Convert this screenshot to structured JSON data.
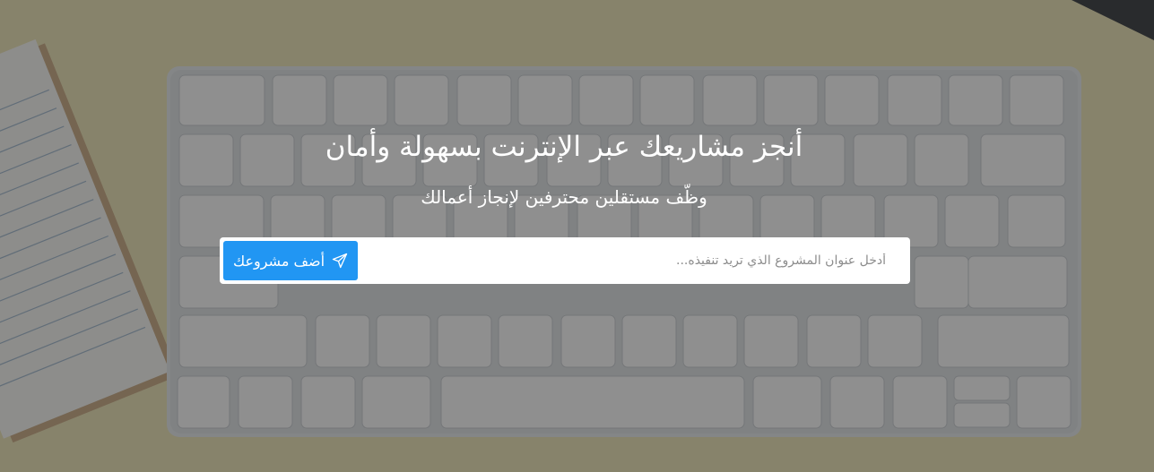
{
  "hero": {
    "title": "أنجز مشاريعك عبر الإنترنت بسهولة وأمان",
    "subtitle": "وظّف مستقلين محترفين لإنجاز أعمالك"
  },
  "project_form": {
    "placeholder": "أدخل عنوان المشروع الذي تريد تنفيذه...",
    "value": "",
    "button_label": "أضف مشروعك",
    "button_icon": "paper-plane-icon",
    "button_color": "#2196f3"
  },
  "colors": {
    "overlay": "#282828",
    "desk": "#efe6b5",
    "keyboard": "#e9ecee",
    "key": "#ffffff"
  }
}
